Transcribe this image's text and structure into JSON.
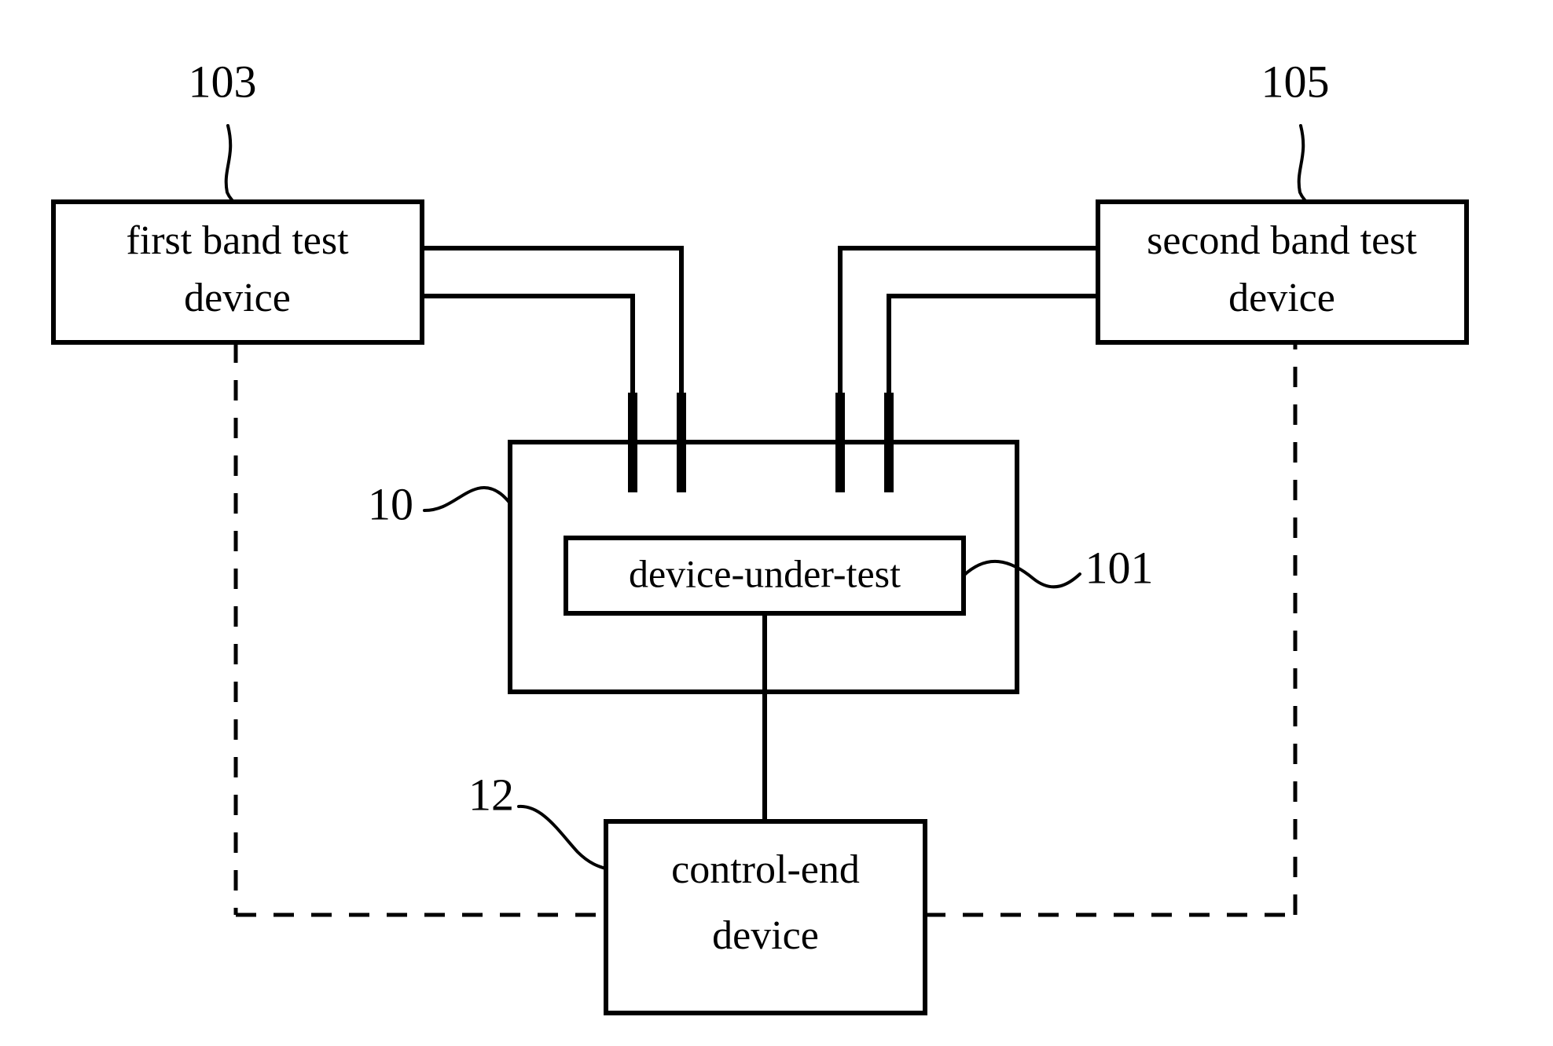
{
  "figure": {
    "type": "patent-block-diagram",
    "background_color": "#ffffff",
    "line_color": "#000000"
  },
  "blocks": {
    "first_band_test_device": {
      "label_line1": "first band test",
      "label_line2": "device",
      "reference_numeral": "103"
    },
    "second_band_test_device": {
      "label_line1": "second band test",
      "label_line2": "device",
      "reference_numeral": "105"
    },
    "test_fixture": {
      "reference_numeral": "10"
    },
    "device_under_test": {
      "label": "device-under-test",
      "reference_numeral": "101"
    },
    "control_end_device": {
      "label_line1": "control-end",
      "label_line2": "device",
      "reference_numeral": "12"
    }
  },
  "connections": {
    "first_band_upper": "solid",
    "first_band_lower": "solid",
    "second_band_upper": "solid",
    "second_band_lower": "solid",
    "dut_to_control": "solid",
    "control_bus": "dashed"
  }
}
